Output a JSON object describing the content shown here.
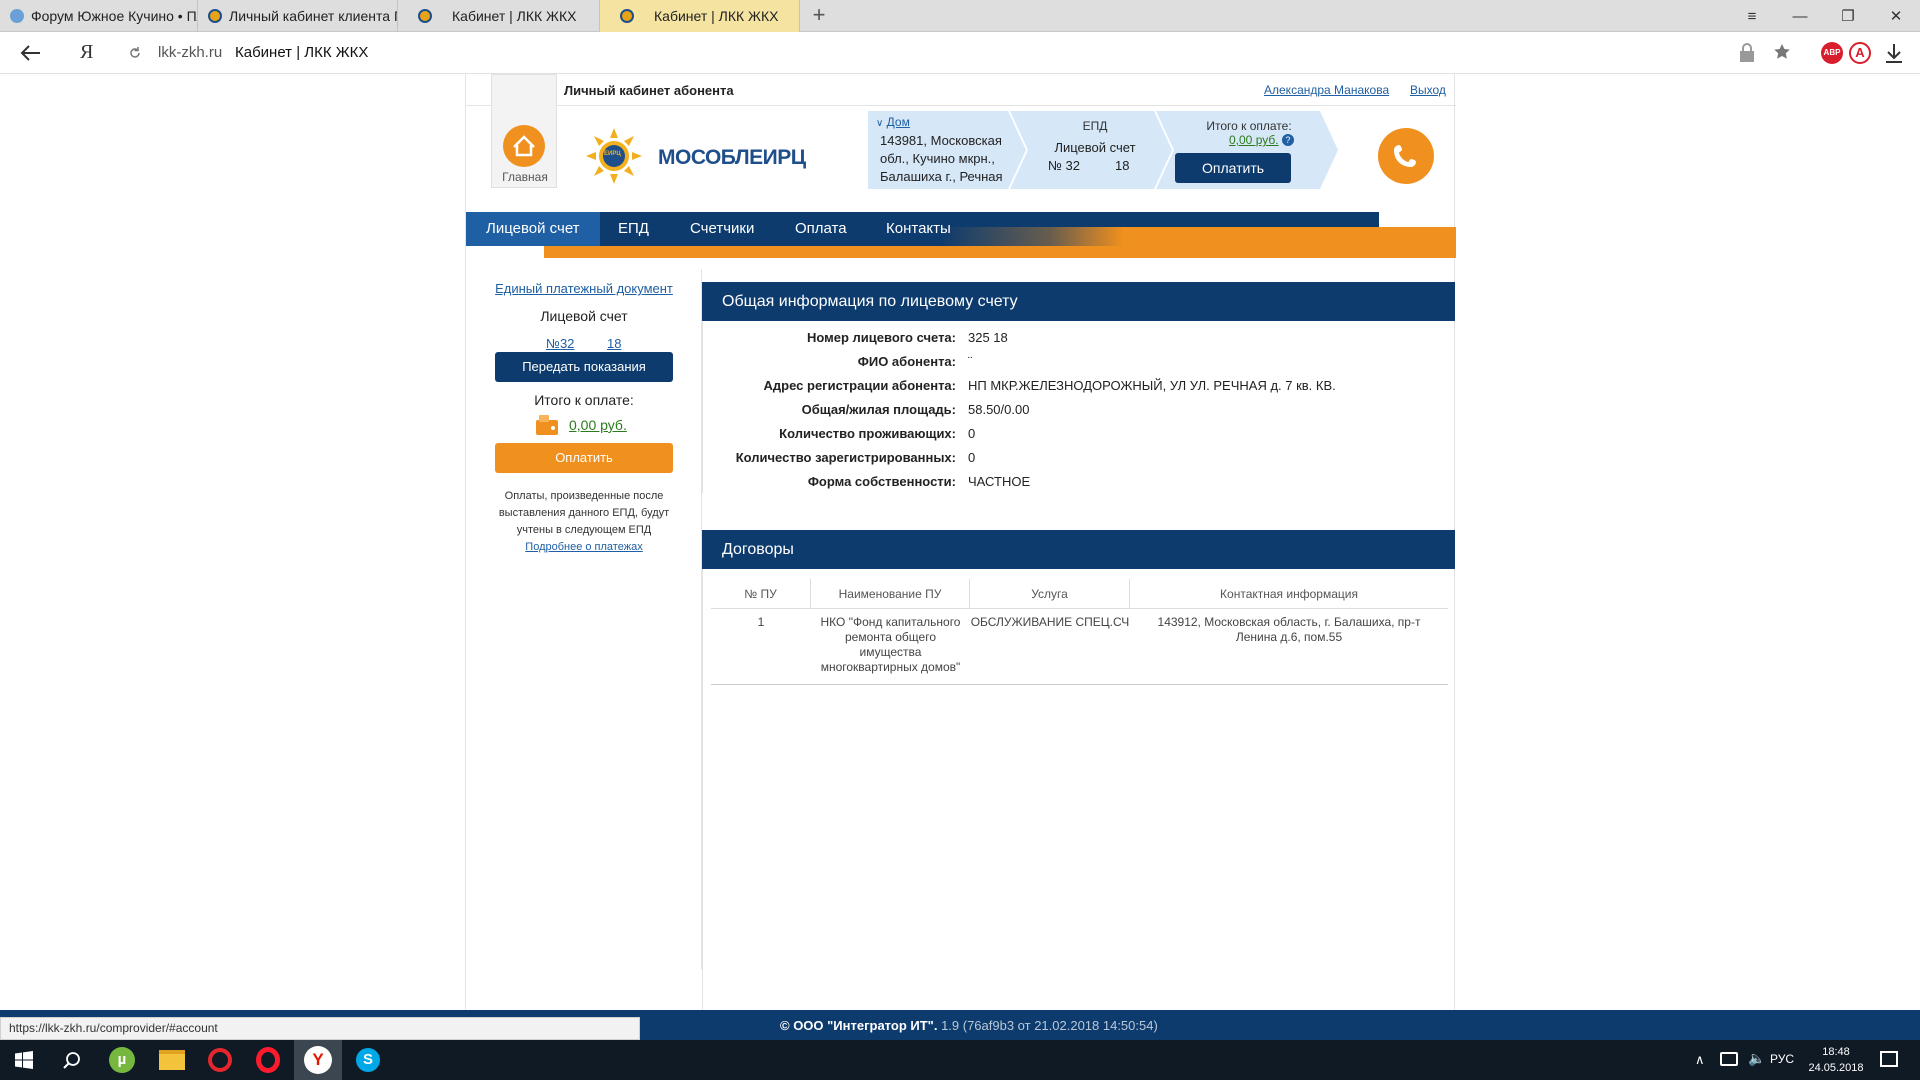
{
  "browser": {
    "tabs": [
      {
        "label": "Форум Южное Кучино • Пл",
        "favicon_color": "#6aa0d8"
      },
      {
        "label": "Личный кабинет клиента П",
        "favicon_color": "#e8a317"
      },
      {
        "label": "Кабинет | ЛКК ЖКХ",
        "favicon_color": "#e8a317"
      },
      {
        "label": "Кабинет | ЛКК ЖКХ",
        "favicon_color": "#e8a317"
      }
    ],
    "new_tab": "+",
    "window_controls": {
      "menu": "≡",
      "minimize": "—",
      "restore": "❐",
      "close": "✕"
    },
    "address": {
      "domain": "lkk-zkh.ru",
      "title": "Кабинет | ЛКК ЖКХ"
    },
    "ext": {
      "abp": "ABP"
    },
    "status_url": "https://lkk-zkh.ru/comprovider/#account"
  },
  "header": {
    "cabinet_title": "Личный кабинет абонента",
    "user_name": "Александра Манакова",
    "logout": "Выход",
    "home_label": "Главная",
    "logo_text": "МОСОБЛЕИРЦ",
    "logo_badge": "ЕИРЦ",
    "house": {
      "link": "Дом",
      "address_lines": [
        "143981, Московская",
        "обл., Кучино мкрн.,",
        "Балашиха г., Речная"
      ]
    },
    "epd": {
      "title": "ЕПД",
      "account_label": "Лицевой счет",
      "account_number": "№ 32",
      "account_suffix": "18"
    },
    "total": {
      "label": "Итого к оплате:",
      "amount": "0,00 руб.",
      "pay_button": "Оплатить"
    }
  },
  "nav": {
    "items": [
      "Лицевой счет",
      "ЕПД",
      "Счетчики",
      "Оплата",
      "Контакты"
    ],
    "active_index": 0
  },
  "sidebar": {
    "epd_link": "Единый платежный документ",
    "account_label": "Лицевой счет",
    "account_number": "№32",
    "account_suffix": "18",
    "submit_readings": "Передать показания",
    "total_label": "Итого к оплате:",
    "amount": "0,00 руб.",
    "pay_button": "Оплатить",
    "note": [
      "Оплаты, произведенные после",
      "выставления данного ЕПД, будут",
      "учтены в следующем ЕПД"
    ],
    "payments_link": "Подробнее о платежах"
  },
  "general_info": {
    "title": "Общая информация по лицевому счету",
    "rows": [
      {
        "label": "Номер лицевого счета:",
        "value": "325      18"
      },
      {
        "label": "ФИО абонента:",
        "value": "¨"
      },
      {
        "label": "Адрес регистрации абонента:",
        "value": "НП МКР.ЖЕЛЕЗНОДОРОЖНЫЙ, УЛ УЛ. РЕЧНАЯ д. 7 кв. КВ."
      },
      {
        "label": "Общая/жилая площадь:",
        "value": "58.50/0.00"
      },
      {
        "label": "Количество проживающих:",
        "value": "0"
      },
      {
        "label": "Количество зарегистрированных:",
        "value": "0"
      },
      {
        "label": "Форма собственности:",
        "value": "ЧАСТНОЕ"
      }
    ]
  },
  "contracts": {
    "title": "Договоры",
    "columns": [
      "№ ПУ",
      "Наименование ПУ",
      "Услуга",
      "Контактная информация"
    ],
    "rows": [
      {
        "num": "1",
        "name_lines": [
          "НКО \"Фонд капитального",
          "ремонта общего",
          "имущества",
          "многоквартирных домов\""
        ],
        "service": "ОБСЛУЖИВАНИЕ СПЕЦ.СЧ",
        "contact_lines": [
          "143912, Московская область, г. Балашиха, пр-т",
          "Ленина д.6, пом.55"
        ]
      }
    ]
  },
  "footer": {
    "copyright": "© ООО \"Интегратор ИТ\".",
    "version": "1.9 (76af9b3 от 21.02.2018 14:50:54)"
  },
  "taskbar": {
    "lang": "РУС",
    "time": "18:48",
    "date": "24.05.2018"
  },
  "colors": {
    "navy": "#0d3b6e",
    "orange": "#f0901e",
    "light_blue": "#d6e7f8",
    "link_green": "#2c7a1e"
  }
}
